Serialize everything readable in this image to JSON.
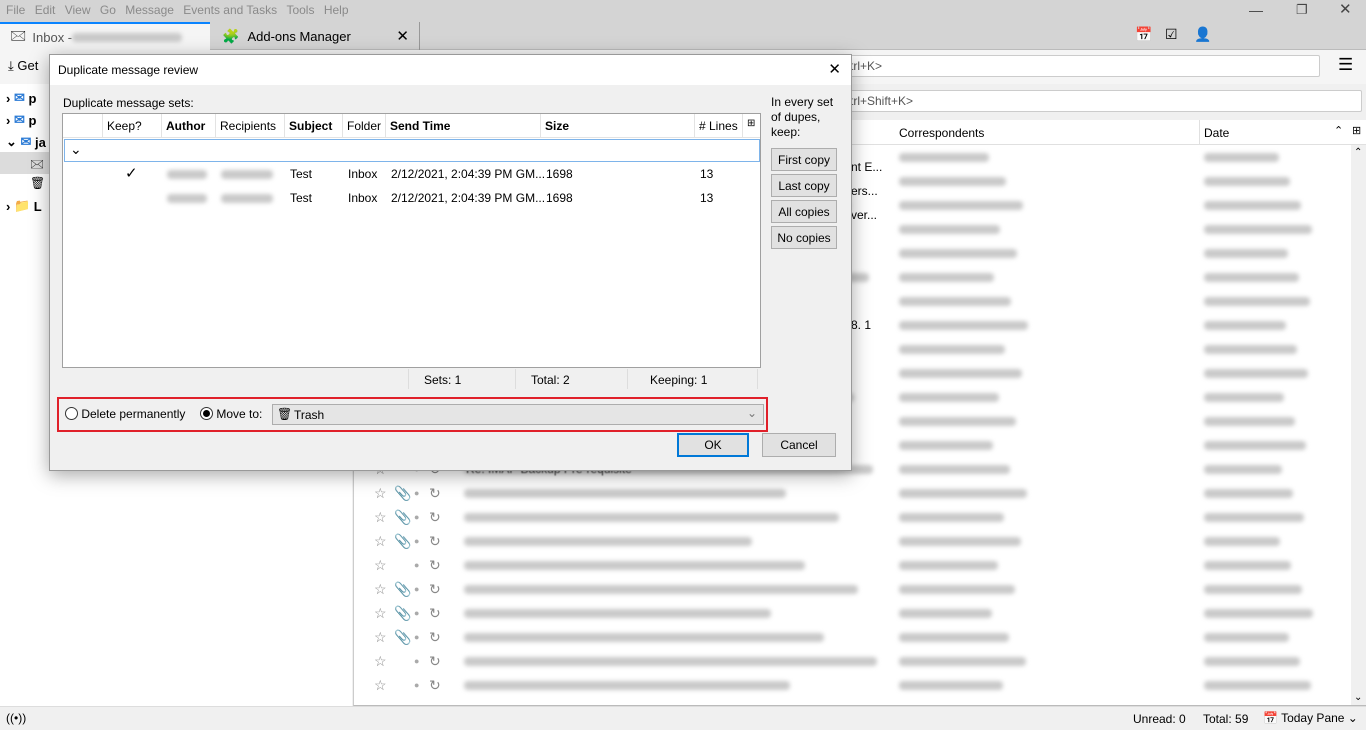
{
  "menubar": [
    "File",
    "Edit",
    "View",
    "Go",
    "Message",
    "Events and Tasks",
    "Tools",
    "Help"
  ],
  "tabs": [
    {
      "label": "Inbox - "
    },
    {
      "label": "Add-ons Manager"
    }
  ],
  "toolbar": {
    "get_label": "Get",
    "search_hint": "trl+K>"
  },
  "quick_filter": {
    "hint": "trl+Shift+K>"
  },
  "folder_pane": {
    "items": [
      {
        "label": "p"
      },
      {
        "label": "p"
      },
      {
        "label": "ja"
      },
      {
        "label": ""
      },
      {
        "label": ""
      },
      {
        "label": "L"
      }
    ]
  },
  "message_list": {
    "columns": {
      "correspondents": "Correspondents",
      "date": "Date"
    },
    "visible_subject_fragments": [
      "nt E...",
      "ers...",
      "ver...",
      "8. 1",
      "Re: IMAP Backup Pre-requisite"
    ],
    "attachment_rows": [
      false,
      false,
      false,
      false,
      false,
      false,
      false,
      false,
      false,
      false,
      false,
      false,
      false,
      false,
      true,
      true,
      true,
      false,
      true,
      true,
      true,
      false,
      false
    ]
  },
  "status": {
    "unread": "Unread: 0",
    "total": "Total: 59",
    "today_pane": "Today Pane"
  },
  "dialog": {
    "title": "Duplicate message review",
    "sets_label": "Duplicate message sets:",
    "columns": [
      "Keep?",
      "Author",
      "Recipients",
      "Subject",
      "Folder",
      "Send Time",
      "Size",
      "# Lines"
    ],
    "rows": [
      {
        "keep": "✓",
        "subject": "Test",
        "folder": "Inbox",
        "send_time": "2/12/2021, 2:04:39 PM GM...",
        "size": "1698",
        "lines": "13"
      },
      {
        "keep": "",
        "subject": "Test",
        "folder": "Inbox",
        "send_time": "2/12/2021, 2:04:39 PM GM...",
        "size": "1698",
        "lines": "13"
      }
    ],
    "side_label": "In every set of dupes, keep:",
    "side_buttons": [
      "First copy",
      "Last copy",
      "All copies",
      "No copies"
    ],
    "summary": {
      "sets": "Sets: 1",
      "total": "Total: 2",
      "keeping": "Keeping: 1"
    },
    "action": {
      "delete_label": "Delete permanently",
      "move_label": "Move to:",
      "selected": "move",
      "target_folder": "Trash"
    },
    "ok": "OK",
    "cancel": "Cancel"
  },
  "colors": {
    "highlight_box": "#e0202a",
    "accent": "#0a84ff",
    "ok_border": "#0078d7"
  }
}
